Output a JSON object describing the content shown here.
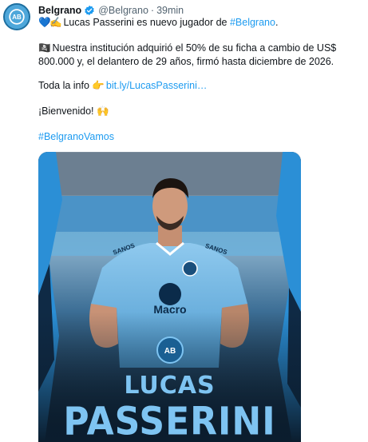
{
  "tweet": {
    "author_name": "Belgrano",
    "verified": true,
    "handle": "@Belgrano",
    "separator": "·",
    "time": "39min",
    "line1": {
      "emoji1": "💙",
      "emoji2": "✍️",
      "text_before": "Lucas Passerini es nuevo jugador de ",
      "hashtag": "#Belgrano",
      "text_after": "."
    },
    "line2": {
      "emoji": "🏴‍☠️",
      "text": "Nuestra institución adquirió el 50% de su ficha a cambio de US$ 800.000 y, el delantero de 29 años, firmó hasta diciembre de 2026."
    },
    "line3": {
      "text": "Toda la info ",
      "emoji": "👉",
      "link": "bit.ly/LucasPasserini…"
    },
    "line4": {
      "text": "¡Bienvenido! ",
      "emoji": "🙌"
    },
    "line5": {
      "hashtag": "#BelgranoVamos"
    },
    "media": {
      "shirt_sponsor": "Macro",
      "sleeve_sponsor": "SANOS",
      "crest_text": "AB",
      "title_first": "LUCAS",
      "title_last": "PASSERINI"
    }
  },
  "colors": {
    "link": "#1d9bf0",
    "club_blue": "#4ea7da",
    "dark_bg": "#0b1d2e",
    "title": "#7ec4f2"
  }
}
